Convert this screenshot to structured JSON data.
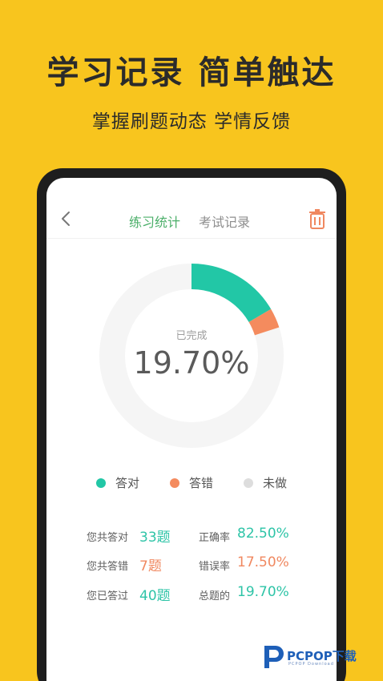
{
  "headline": "学习记录 简单触达",
  "subline": "掌握刷题动态 学情反馈",
  "topbar": {
    "tabs": [
      "练习统计",
      "考试记录"
    ],
    "active_tab": 0
  },
  "summary": {
    "label": "已完成",
    "value": "19.70%",
    "correct_fraction": 0.1655,
    "wrong_fraction": 0.0345
  },
  "legend": [
    {
      "label": "答对",
      "color": "#22C7A6"
    },
    {
      "label": "答错",
      "color": "#F48B5E"
    },
    {
      "label": "未做",
      "color": "#DDDDDD"
    }
  ],
  "stats": {
    "correct": {
      "label": "您共答对",
      "value": "33题"
    },
    "wrong": {
      "label": "您共答错",
      "value": "7题"
    },
    "answered": {
      "label": "您已答过",
      "value": "40题"
    },
    "correct_rate": {
      "label": "正确率",
      "value": "82.50%"
    },
    "wrong_rate": {
      "label": "错误率",
      "value": "17.50%"
    },
    "total_rate": {
      "label": "总题的",
      "value": "19.70%"
    }
  },
  "watermark": {
    "text": "PCPOP下载",
    "sub": "PCPOP Download"
  }
}
